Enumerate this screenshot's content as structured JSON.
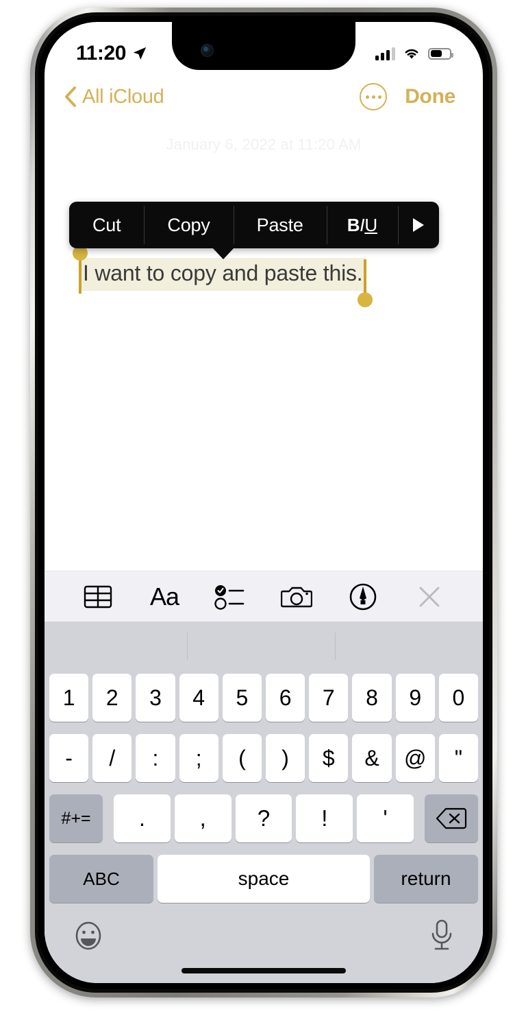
{
  "status_bar": {
    "time": "11:20",
    "location_icon": "location-arrow-icon",
    "signal_icon": "cellular-signal-icon",
    "signal_bars_active": 3,
    "signal_bars_total": 4,
    "wifi_icon": "wifi-icon",
    "battery_icon": "battery-icon",
    "battery_percent": 55
  },
  "nav_bar": {
    "back_icon": "chevron-left-icon",
    "back_label": "All iCloud",
    "more_icon": "more-ellipsis-circle-icon",
    "done_label": "Done"
  },
  "note": {
    "date_line": "January 6, 2022 at 11:20 AM",
    "selected_text": "I want to copy and paste this.",
    "selection_handle_color": "#D8B441",
    "selection_highlight_color": "#F3EFDD",
    "accent_color": "#D3B155"
  },
  "context_menu": {
    "items": [
      {
        "label": "Cut",
        "name": "cut"
      },
      {
        "label": "Copy",
        "name": "copy"
      },
      {
        "label": "Paste",
        "name": "paste"
      }
    ],
    "format_item": {
      "bold": "B",
      "italic": "I",
      "underline": "U"
    },
    "more_arrow_icon": "triangle-right-icon",
    "background_color": "#0b0b0b"
  },
  "note_toolbar": {
    "items": [
      {
        "name": "table-icon",
        "label": "Table"
      },
      {
        "name": "format-aa-icon",
        "label": "Aa"
      },
      {
        "name": "checklist-icon",
        "label": "Checklist"
      },
      {
        "name": "camera-icon",
        "label": "Camera"
      },
      {
        "name": "markup-pen-icon",
        "label": "Markup"
      },
      {
        "name": "close-icon",
        "label": "Close"
      }
    ]
  },
  "keyboard": {
    "layout": "numeric-symbols",
    "predictive_bar": {
      "suggestions": []
    },
    "row1": [
      "1",
      "2",
      "3",
      "4",
      "5",
      "6",
      "7",
      "8",
      "9",
      "0"
    ],
    "row2": [
      "-",
      "/",
      ":",
      ";",
      "(",
      ")",
      "$",
      "&",
      "@",
      "\""
    ],
    "row3_shift_label": "#+=",
    "row3": [
      ".",
      ",",
      "?",
      "!",
      "'"
    ],
    "row3_backspace_icon": "backspace-icon",
    "row4": {
      "abc_label": "ABC",
      "space_label": "space",
      "return_label": "return"
    },
    "bottom": {
      "emoji_icon": "emoji-smiley-icon",
      "mic_icon": "microphone-icon"
    }
  }
}
